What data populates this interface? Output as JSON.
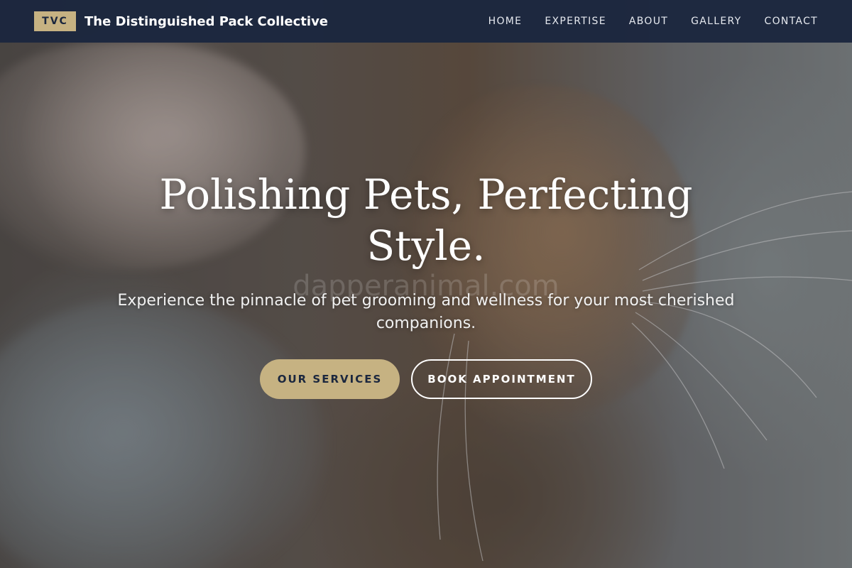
{
  "brand": {
    "badge": "TVC",
    "name": "The Distinguished Pack Collective"
  },
  "nav": {
    "items": [
      {
        "label": "HOME"
      },
      {
        "label": "EXPERTISE"
      },
      {
        "label": "ABOUT"
      },
      {
        "label": "GALLERY"
      },
      {
        "label": "CONTACT"
      }
    ]
  },
  "hero": {
    "headline": "Polishing Pets, Perfecting Style.",
    "subheadline": "Experience the pinnacle of pet grooming and wellness for your most cherished companions.",
    "watermark": "dapperanimal.com",
    "primary_cta": "OUR SERVICES",
    "secondary_cta": "BOOK APPOINTMENT"
  },
  "colors": {
    "nav_background": "#1b273e",
    "accent_gold": "#c6b282",
    "text_light": "#ffffff"
  }
}
